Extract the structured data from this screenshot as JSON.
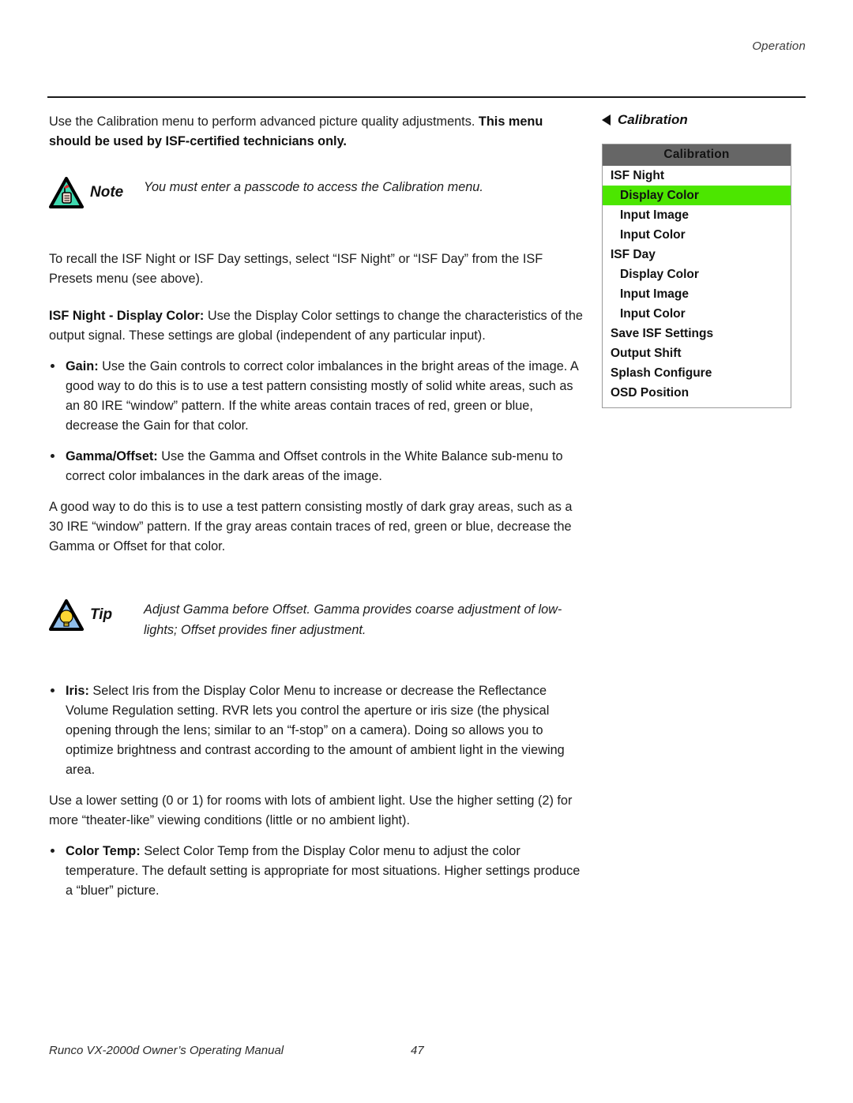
{
  "header": {
    "running_head": "Operation"
  },
  "footer": {
    "manual_title": "Runco VX-2000d Owner’s Operating Manual",
    "page_number": "47"
  },
  "main": {
    "intro": {
      "normal": "Use the Calibration menu to perform advanced picture quality adjustments. ",
      "bold": "This menu should be used by ISF-certified technicians only."
    },
    "note_callout": {
      "label": "Note",
      "icon": "note-triangle-hand-icon",
      "text": "You must enter a passcode to access the Calibration menu."
    },
    "recall_para": "To recall the ISF Night or ISF Day settings, select “ISF Night” or “ISF Day” from the ISF Presets menu (see above).",
    "display_color_para": {
      "bold": "ISF Night - Display Color:",
      "normal": " Use the Display Color settings to change the characteristics of the output signal. These settings are global (independent of any particular input)."
    },
    "bullets": [
      {
        "term": "Gain:",
        "text": " Use the Gain controls to correct color imbalances in the bright areas of the image. A good way to do this is to use a test pattern consisting mostly of solid white areas, such as an 80 IRE “window” pattern. If the white areas contain traces of red, green or blue, decrease the Gain for that color."
      },
      {
        "term": "Gamma/Offset:",
        "text": " Use the Gamma and Offset controls in the White Balance sub-menu to correct color imbalances in the dark areas of the image."
      }
    ],
    "gamma_subpara": "A good way to do this is to use a test pattern consisting mostly of dark gray areas, such as a 30 IRE “window” pattern. If the gray areas contain traces of red, green or blue, decrease the Gamma or Offset for that color.",
    "tip_callout": {
      "label": "Tip",
      "icon": "tip-triangle-lightbulb-icon",
      "text": "Adjust Gamma before Offset. Gamma provides coarse adjustment of low-lights; Offset provides finer adjustment."
    },
    "bullets2": [
      {
        "term": "Iris:",
        "text": " Select Iris from the Display Color Menu to increase or decrease the Reflectance Volume Regulation setting. RVR lets you control the aperture or iris size (the physical opening through the lens; similar to an “f-stop” on a camera). Doing so allows you to optimize brightness and contrast according to the amount of ambient light in the viewing area."
      }
    ],
    "iris_subpara": "Use a lower setting (0 or 1) for rooms with lots of ambient light. Use the higher setting (2) for more “theater-like” viewing conditions (little or no ambient light).",
    "bullets3": [
      {
        "term": "Color Temp:",
        "text": " Select Color Temp from the Display Color menu to adjust the color temperature. The default setting is appropriate for most situations. Higher settings produce a “bluer” picture."
      }
    ]
  },
  "figure": {
    "caption": "Calibration",
    "caret_icon": "caret-left-icon",
    "osd": {
      "title": "Calibration",
      "highlight_color": "#4ce600",
      "titlebar_color": "#666666",
      "rows": [
        {
          "label": "ISF Night",
          "level": 1,
          "selected": false
        },
        {
          "label": "Display Color",
          "level": 2,
          "selected": true
        },
        {
          "label": "Input Image",
          "level": 2,
          "selected": false
        },
        {
          "label": "Input Color",
          "level": 2,
          "selected": false
        },
        {
          "label": "ISF Day",
          "level": 1,
          "selected": false
        },
        {
          "label": "Display Color",
          "level": 2,
          "selected": false
        },
        {
          "label": "Input Image",
          "level": 2,
          "selected": false
        },
        {
          "label": "Input Color",
          "level": 2,
          "selected": false
        },
        {
          "label": "Save ISF Settings",
          "level": 1,
          "selected": false
        },
        {
          "label": "Output Shift",
          "level": 1,
          "selected": false
        },
        {
          "label": "Splash Configure",
          "level": 1,
          "selected": false
        },
        {
          "label": "OSD Position",
          "level": 1,
          "selected": false
        }
      ]
    }
  }
}
